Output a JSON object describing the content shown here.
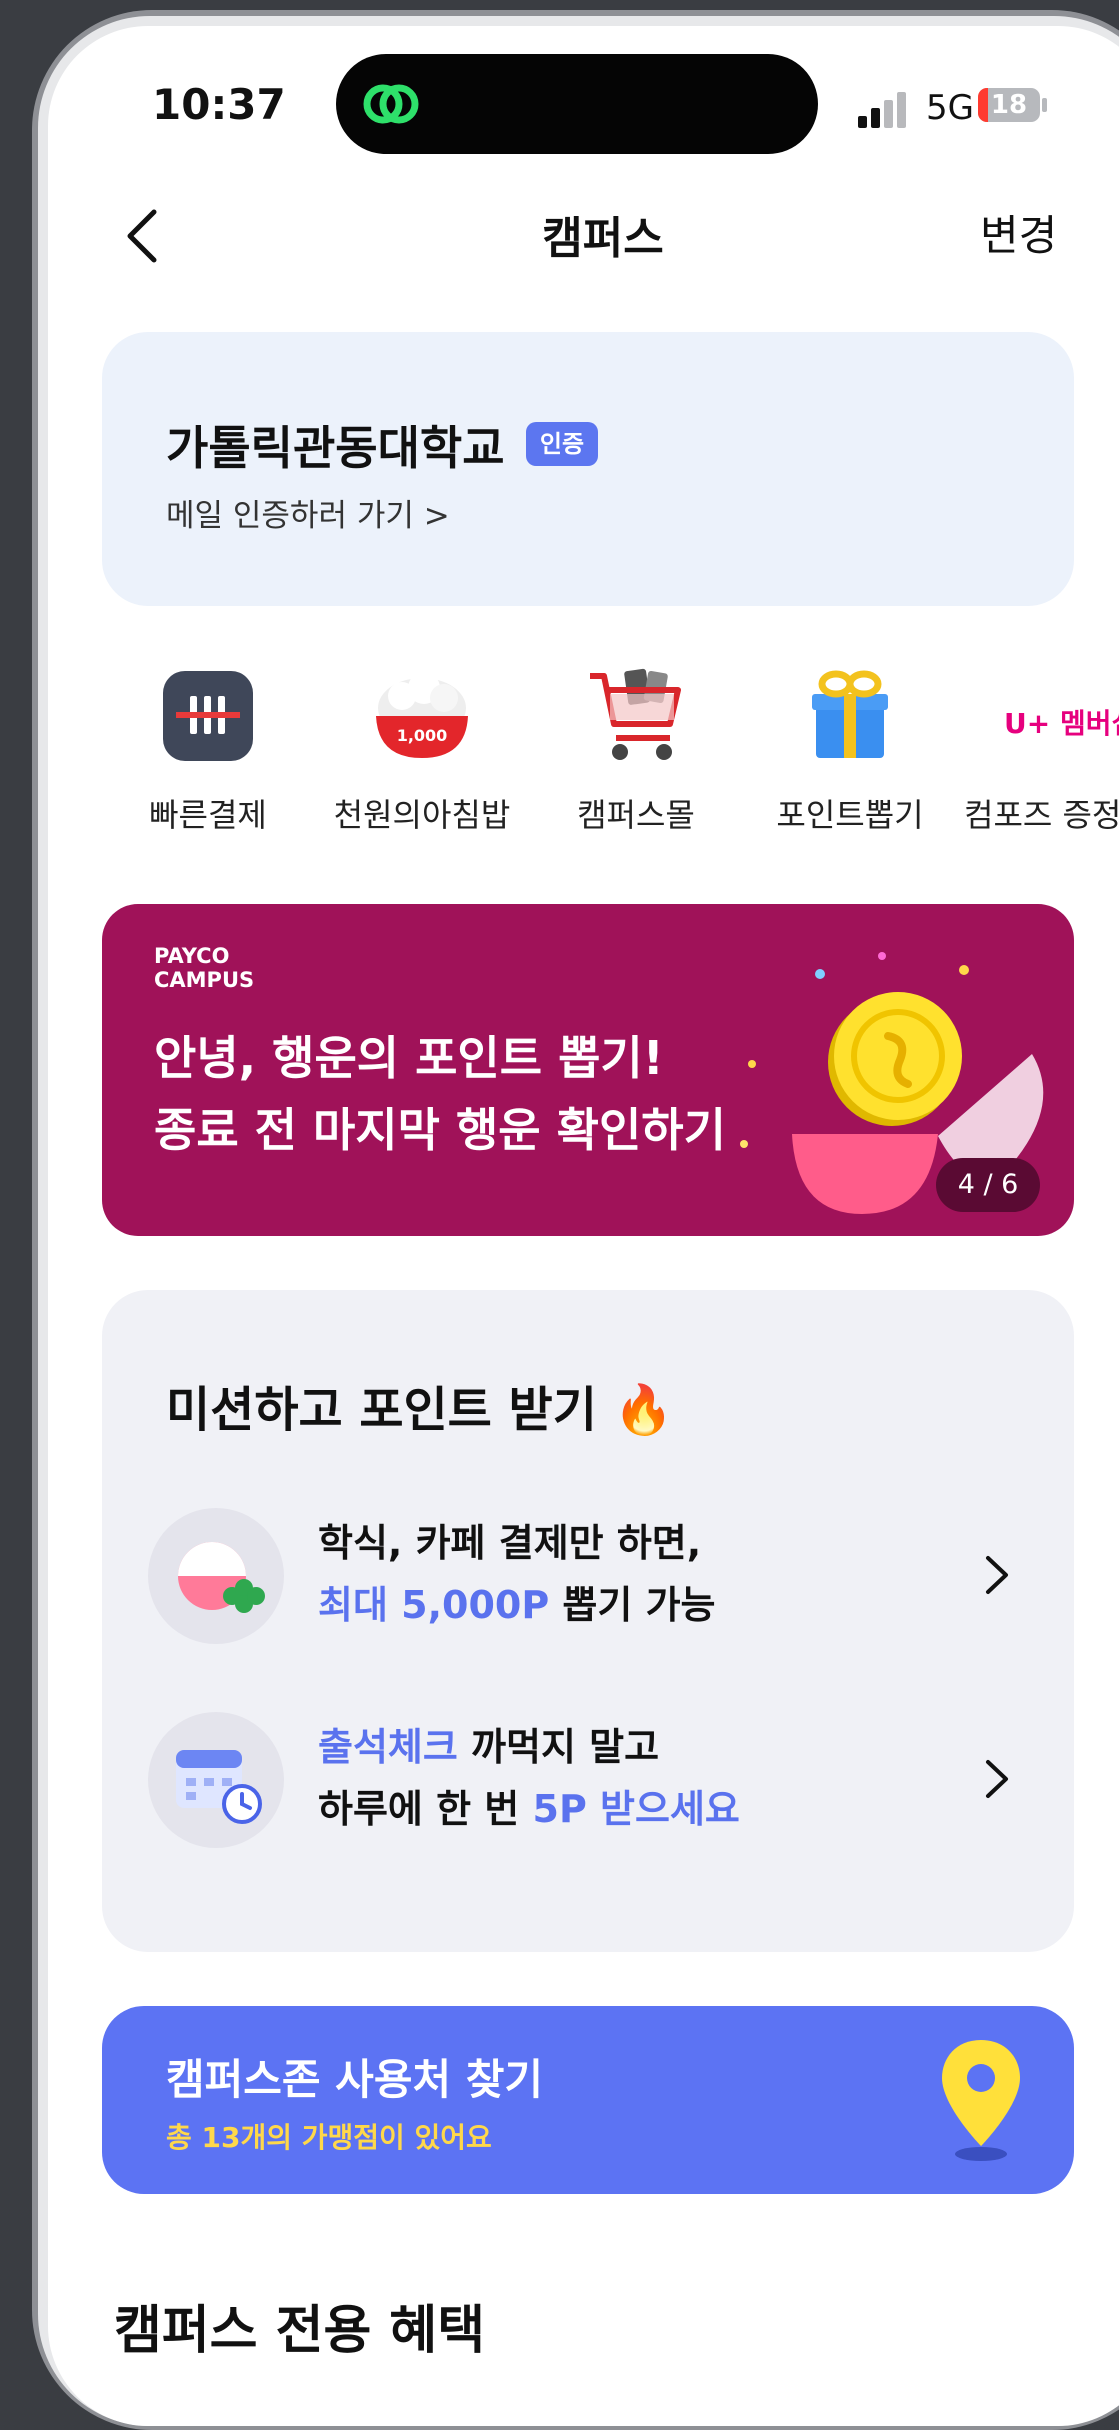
{
  "status_bar": {
    "time": "10:37",
    "network": "5G",
    "battery": "18"
  },
  "nav": {
    "title": "캠퍼스",
    "action": "변경"
  },
  "school": {
    "name": "가톨릭관동대학교",
    "badge": "인증",
    "link": "메일 인증하러 가기 >"
  },
  "quick_menu": [
    {
      "label": "빠른결제",
      "icon": "fast-pay-icon"
    },
    {
      "label": "천원의아침밥",
      "icon": "rice-bowl-icon",
      "icon_text": "1,000"
    },
    {
      "label": "캠퍼스몰",
      "icon": "shopping-cart-icon"
    },
    {
      "label": "포인트뽑기",
      "icon": "gift-box-icon"
    },
    {
      "label": "컴포즈 증정",
      "icon": "u-plus-membership-icon",
      "icon_text": "U+ 멤버십"
    }
  ],
  "banner": {
    "brand_line1": "PAYCO",
    "brand_line2": "CAMPUS",
    "line1": "안녕, 행운의 포인트 뽑기!",
    "line2": "종료 전 마지막 행운 확인하기",
    "page_indicator": "4 / 6"
  },
  "missions": {
    "title": "미션하고 포인트 받기 🔥",
    "items": [
      {
        "line1": "학식, 카페 결제만 하면,",
        "line2_highlight": "최대 5,000P",
        "line2_rest": " 뽑기 가능"
      },
      {
        "line1_highlight": "출석체크",
        "line1_rest": " 까먹지 말고",
        "line2_plain": "하루에 한 번 ",
        "line2_highlight": "5P 받으세요"
      }
    ]
  },
  "zone": {
    "title": "캠퍼스존 사용처 찾기",
    "subtitle": "총 13개의 가맹점이 있어요"
  },
  "section": {
    "title": "캠퍼스 전용 혜택"
  },
  "colors": {
    "accent": "#5c73f3",
    "banner": "#a01259",
    "highlight": "#5a72ee",
    "zone_sub": "#ffd84a"
  }
}
